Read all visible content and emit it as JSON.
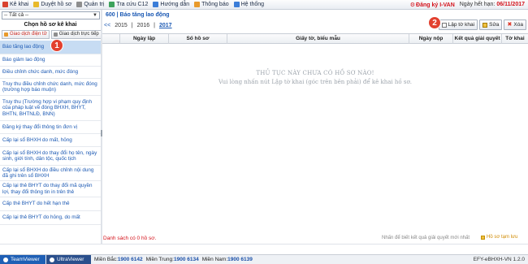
{
  "menubar": {
    "items": [
      {
        "label": "Kê khai",
        "icon": "declare-icon"
      },
      {
        "label": "Duyệt hồ sơ",
        "icon": "review-icon"
      },
      {
        "label": "Quản trị",
        "icon": "admin-icon"
      },
      {
        "label": "Tra cứu C12",
        "icon": "lookup-icon"
      },
      {
        "label": "Hướng dẫn",
        "icon": "help-icon"
      },
      {
        "label": "Thông báo",
        "icon": "notification-icon"
      },
      {
        "label": "Hệ thống",
        "icon": "system-icon"
      }
    ],
    "register_label": "Đăng ký I-VAN",
    "expiry_label": "Ngày hết hạn:",
    "expiry_date": "06/11/2017"
  },
  "sidebar": {
    "filter_value": "-- Tất cả --",
    "title": "Chọn hồ sơ kê khai",
    "tabs": [
      "Giao dịch điện tử",
      "Giao dịch trực tiếp"
    ],
    "items": [
      "Báo tăng lao động",
      "Báo giảm lao động",
      "Điều chỉnh chức danh, mức đóng",
      "Truy thu điều chỉnh chức danh, mức đóng (trường hợp báo muộn)",
      "Truy thu (Trường hợp vi phạm quy định của pháp luật về đóng BHXH, BHYT, BHTN, BHTNLĐ, BNN)",
      "Đăng ký thay đổi thông tin đơn vị",
      "Cấp lại sổ BHXH do mất, hỏng",
      "Cấp lại sổ BHXH do thay đổi họ tên, ngày sinh, giới tính, dân tộc, quốc tịch",
      "Cấp lại sổ BHXH do điều chỉnh nội dung đã ghi trên sổ BHXH",
      "Cấp lại thẻ BHYT do thay đổi mã quyền lợi, thay đổi thông tin in trên thẻ",
      "Cấp thẻ BHYT do hết hạn thẻ",
      "Cấp lại thẻ BHYT do hỏng, do mất"
    ],
    "selected_index": 0
  },
  "callouts": {
    "one": "1",
    "two": "2"
  },
  "content": {
    "breadcrumb": "600 | Báo tăng lao động",
    "year_prev": "<<",
    "years": [
      "2015",
      "2016",
      "2017"
    ],
    "active_year": "2017",
    "toolbar": {
      "create": "Lập tờ khai",
      "edit": "Sửa",
      "delete": "Xóa"
    },
    "columns": [
      "Ngày lập",
      "Số hồ sơ",
      "Giấy tờ, biểu mẫu",
      "Ngày nộp",
      "Kết quả giải quyết",
      "Tờ khai"
    ],
    "empty_title": "THỦ TỤC NÀY CHƯA CÓ HỒ SƠ NÀO!",
    "empty_hint": "Vui lòng nhấn nút Lập tờ khai (góc trên bên phải) để kê khai hồ sơ.",
    "count_text": "Danh sách có 0 hồ sơ.",
    "result_hint": "Nhấn để biết kết quả giải quyết mới nhất",
    "draft_label": "Hồ sơ tạm lưu"
  },
  "statusbar": {
    "teamviewer": "TeamViewer",
    "ultraviewer": "UltraViewer",
    "north_label": "Miền Bắc:",
    "north_phone": "1900 6142",
    "central_label": "Miền Trung:",
    "central_phone": "1900 6134",
    "south_label": "Miền Nam:",
    "south_phone": "1900 6139",
    "version": "EFY-eBHXH-VN 1.2.0"
  }
}
